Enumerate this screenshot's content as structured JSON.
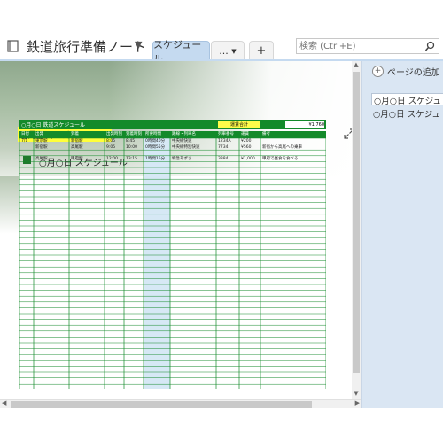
{
  "notebook": {
    "title": "鉄道旅行準備ノート",
    "icon": "notebook-icon"
  },
  "tabs": [
    {
      "label": "スケジュール",
      "active": true
    },
    {
      "label": "...",
      "active": false
    }
  ],
  "search": {
    "placeholder": "検索 (Ctrl+E)"
  },
  "page": {
    "title": "○月○日 スケジュール",
    "subtitle": "○月○日 スケジュール"
  },
  "sidebar": {
    "add_page": "ページの追加",
    "pages": [
      {
        "label": "○月○日 スケジュ",
        "selected": true
      },
      {
        "label": "○月○日 スケジュ",
        "selected": false
      }
    ]
  },
  "sheet": {
    "title": "○月○日 鉄道スケジュール",
    "total_label": "運賃合計",
    "total_value": "¥1,760",
    "columns": [
      "日付",
      "出発",
      "到着",
      "出発時刻",
      "到着時刻",
      "所要時間",
      "路線・列車名",
      "列車番号",
      "運賃",
      "備考"
    ],
    "rows": [
      [
        "7/1",
        "東京駅",
        "新宿駅",
        "8:05",
        "8:45",
        "0時間40分",
        "中央線快速",
        "1234A",
        "¥200",
        ""
      ],
      [
        "",
        "新宿駅",
        "高尾駅",
        "9:05",
        "10:00",
        "0時間55分",
        "中央線特別快速",
        "7734",
        "¥560",
        "新宿から高尾への乗車"
      ],
      [
        "",
        "高尾駅",
        "甲府駅",
        "12:00",
        "13:15",
        "1時間15分",
        "特急あずさ",
        "3384",
        "¥1,000",
        "甲府で昼食を食べる"
      ]
    ],
    "accent": "#138a2a",
    "highlight_col": "#d6e8f5"
  },
  "colors": {
    "sidebar": "#dae6f3",
    "tab_active": "#c5daf0",
    "title_highlight": "#ffff3a"
  }
}
